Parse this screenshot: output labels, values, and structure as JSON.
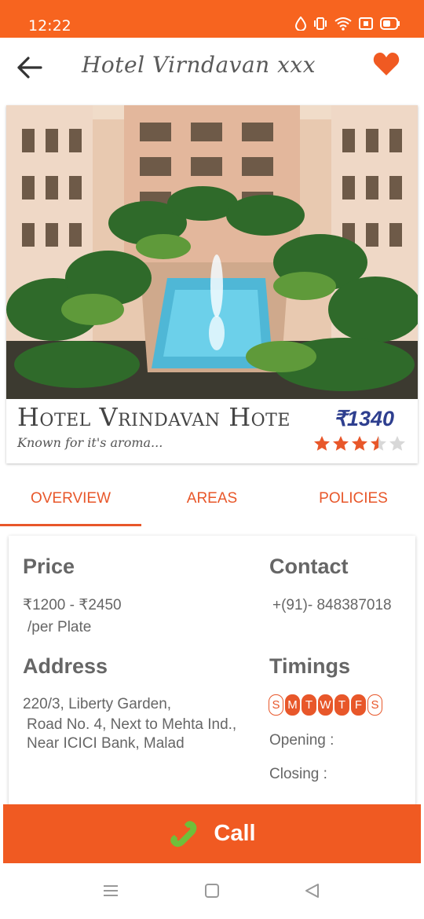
{
  "status_bar": {
    "time": "12:22"
  },
  "app_bar": {
    "title": "Hotel Virndavan xxx"
  },
  "hero": {
    "name": "Hotel Vrindavan Hote",
    "tagline": "Known for it's aroma...",
    "price": "₹1340",
    "rating": 3.5
  },
  "tabs": [
    {
      "label": "OVERVIEW"
    },
    {
      "label": "AREAS"
    },
    {
      "label": "POLICIES"
    }
  ],
  "active_tab": "OVERVIEW",
  "details": {
    "price_heading": "Price",
    "price_range": "₹1200 - ₹2450",
    "price_unit": "/per Plate",
    "contact_heading": "Contact",
    "contact_phone": "+(91)- 848387018",
    "address_heading": "Address",
    "address_line1": "220/3, Liberty Garden,",
    "address_line2": "Road No. 4, Next to Mehta Ind.,",
    "address_line3": "Near ICICI Bank, Malad",
    "timings_heading": "Timings",
    "days": [
      {
        "letter": "S",
        "open": false
      },
      {
        "letter": "M",
        "open": true
      },
      {
        "letter": "T",
        "open": true
      },
      {
        "letter": "W",
        "open": true
      },
      {
        "letter": "T",
        "open": true
      },
      {
        "letter": "F",
        "open": true
      },
      {
        "letter": "S",
        "open": false
      }
    ],
    "opening_label": "Opening :",
    "closing_label": "Closing :"
  },
  "call_button": {
    "label": "Call"
  },
  "colors": {
    "accent": "#f05a22",
    "status_bar": "#f7641f",
    "price": "#2e3f8f",
    "star": "#e8572a"
  }
}
